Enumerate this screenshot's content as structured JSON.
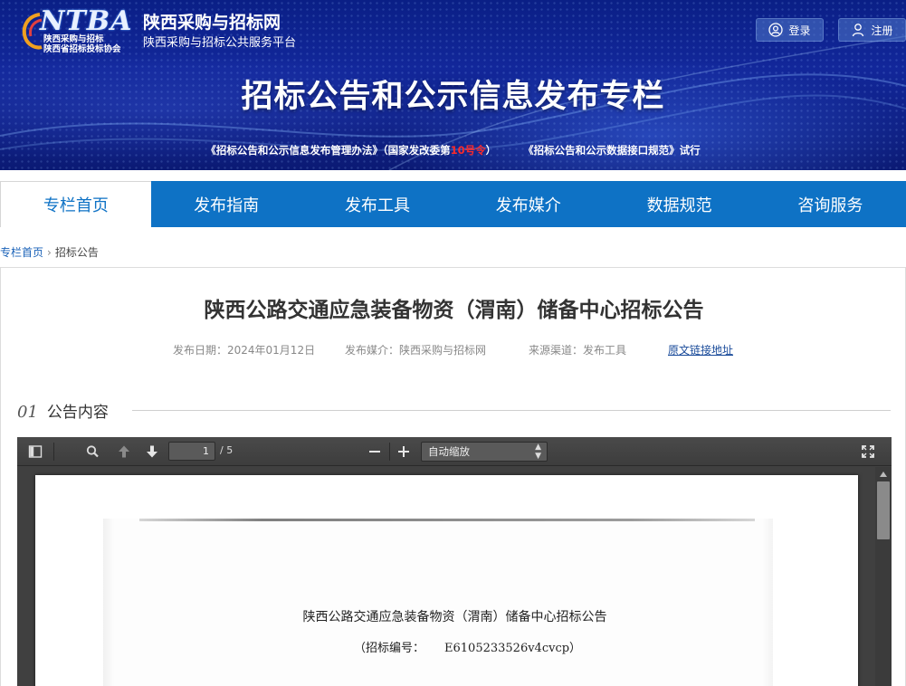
{
  "header": {
    "logo_text": "NTBA",
    "logo_org_line1": "陕西采购与招标",
    "logo_org_line2": "陕西省招标投标协会",
    "site_title": "陕西采购与招标网",
    "site_subtitle": "陕西采购与招标公共服务平台",
    "login_label": "登录",
    "register_label": "注册",
    "banner_title": "招标公告和公示信息发布专栏",
    "note_part1": "《招标公告和公示信息发布管理办法》（国家发改委第",
    "note_red": "10号令",
    "note_part2": "）",
    "note_part3": "《招标公告和公示数据接口规范》试行"
  },
  "nav": {
    "items": [
      {
        "label": "专栏首页"
      },
      {
        "label": "发布指南"
      },
      {
        "label": "发布工具"
      },
      {
        "label": "发布媒介"
      },
      {
        "label": "数据规范"
      },
      {
        "label": "咨询服务"
      }
    ]
  },
  "breadcrumb": {
    "home": "专栏首页",
    "current": "招标公告"
  },
  "article": {
    "title": "陕西公路交通应急装备物资（渭南）储备中心招标公告",
    "publish_date": "发布日期：2024年01月12日",
    "publish_media": "发布媒介：陕西采购与招标网",
    "source_channel": "来源渠道：发布工具",
    "original_link": "原文链接地址"
  },
  "section": {
    "number": "01",
    "label": "公告内容"
  },
  "pdf_viewer": {
    "page_current": "1",
    "page_total": "/ 5",
    "zoom": "自动缩放",
    "doc_title": "陕西公路交通应急装备物资（渭南）储备中心招标公告",
    "doc_no_label": "（招标编号：",
    "doc_no_value": "E6105233526v4cvcp）"
  }
}
